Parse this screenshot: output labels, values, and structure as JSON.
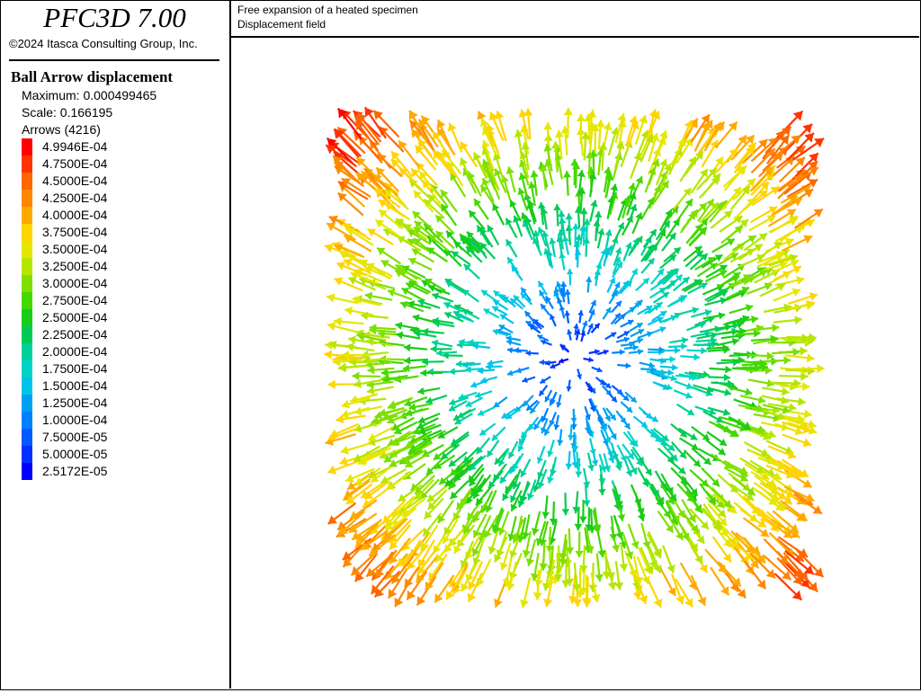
{
  "app": {
    "title": "PFC3D 7.00",
    "copyright": "©2024 Itasca Consulting Group, Inc."
  },
  "header": {
    "line1": "Free expansion of a heated specimen",
    "line2": "Displacement field"
  },
  "legend": {
    "title": "Ball Arrow displacement",
    "maximum": "Maximum: 0.000499465",
    "scale": "Scale: 0.166195",
    "arrows": "Arrows (4216)",
    "ticks": [
      "4.9946E-04",
      "4.7500E-04",
      "4.5000E-04",
      "4.2500E-04",
      "4.0000E-04",
      "3.7500E-04",
      "3.5000E-04",
      "3.2500E-04",
      "3.0000E-04",
      "2.7500E-04",
      "2.5000E-04",
      "2.2500E-04",
      "2.0000E-04",
      "1.7500E-04",
      "1.5000E-04",
      "1.2500E-04",
      "1.0000E-04",
      "7.5000E-05",
      "5.0000E-05",
      "2.5172E-05"
    ],
    "colors": [
      "#ff0000",
      "#ff3300",
      "#ff6600",
      "#ff8800",
      "#ffaa00",
      "#ffd400",
      "#e6e600",
      "#b4e600",
      "#7ee000",
      "#44d800",
      "#18cc18",
      "#00cc55",
      "#00d09a",
      "#00d4c8",
      "#00c4e8",
      "#00a0f0",
      "#0080ff",
      "#0058ff",
      "#0030ff",
      "#0000ff"
    ]
  },
  "field": {
    "max": 0.000499465,
    "arrow_count": 4216
  }
}
